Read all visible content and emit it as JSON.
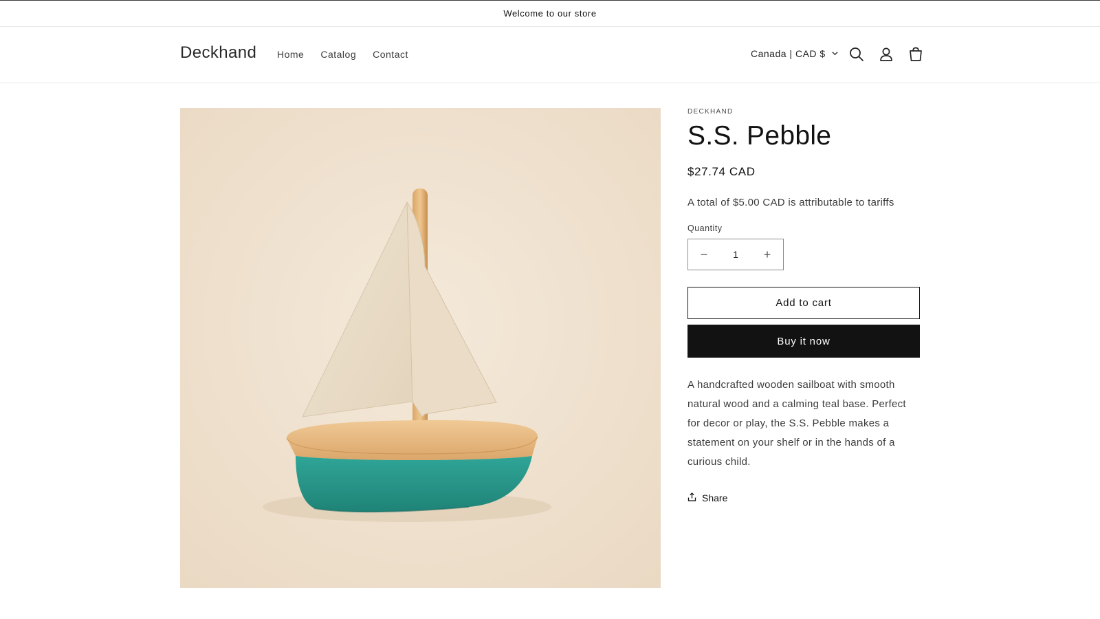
{
  "announcement": {
    "text": "Welcome to our store"
  },
  "header": {
    "logo": "Deckhand",
    "nav": [
      {
        "label": "Home"
      },
      {
        "label": "Catalog"
      },
      {
        "label": "Contact"
      }
    ],
    "currency": "Canada | CAD $",
    "icons": [
      "search-icon",
      "account-icon",
      "cart-icon"
    ]
  },
  "product": {
    "image_alt": "S.S. Pebble wooden sailboat",
    "vendor": "DECKHAND",
    "title": "S.S. Pebble",
    "price": "$27.74 CAD",
    "tariff_note": "A total of $5.00 CAD is attributable to tariffs",
    "quantity_label": "Quantity",
    "quantity_value": "1",
    "decrease_symbol": "−",
    "increase_symbol": "+",
    "add_to_cart": "Add to cart",
    "buy_now": "Buy it now",
    "description": "A handcrafted wooden sailboat with smooth natural wood and a calming teal base. Perfect for decor or play, the S.S. Pebble makes a statement on your shelf or in the hands of a curious child.",
    "share": "Share"
  },
  "colors": {
    "button_dark": "#121212",
    "text": "#121212",
    "image_background": "#efe2d0",
    "hull_teal": "#2c9a8e",
    "wood": "#e6b97e"
  }
}
